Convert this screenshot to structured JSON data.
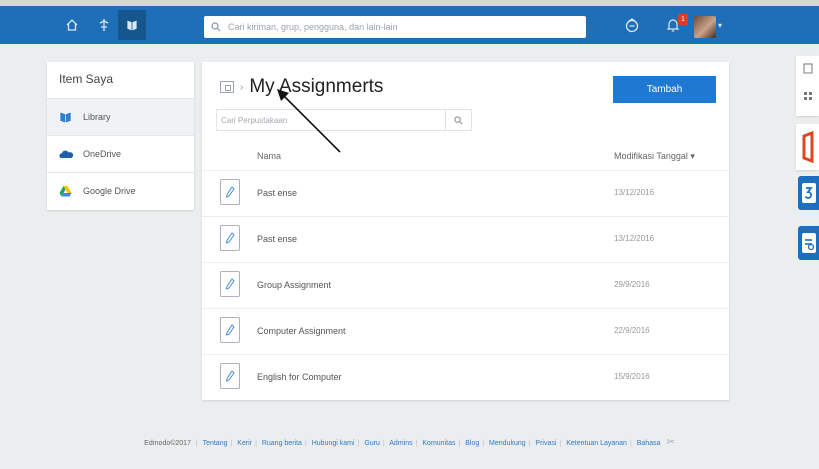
{
  "nav": {
    "search_placeholder": "Cari kiriman, grup, pengguna, dan lain-lain",
    "notification_count": "1"
  },
  "sidebar": {
    "title": "Item Saya",
    "items": [
      {
        "label": "Library",
        "icon": "library-icon"
      },
      {
        "label": "OneDrive",
        "icon": "onedrive-icon"
      },
      {
        "label": "Google Drive",
        "icon": "google-drive-icon"
      }
    ]
  },
  "main": {
    "title": "My Assignmerts",
    "add_label": "Tambah",
    "search_placeholder": "Cari Perpustakaan",
    "columns": {
      "name": "Nama",
      "date": "Modifikasi Tanggal ▾"
    },
    "rows": [
      {
        "name": "Past ense",
        "date": "13/12/2016"
      },
      {
        "name": "Past ense",
        "date": "13/12/2016"
      },
      {
        "name": "Group Assignment",
        "date": "29/9/2016"
      },
      {
        "name": "Computer Assignment",
        "date": "22/9/2016"
      },
      {
        "name": "English for Computer",
        "date": "15/9/2016"
      }
    ]
  },
  "footer": {
    "copyright": "Edmodo©2017",
    "links": [
      "Tentang",
      "Kerir",
      "Ruang berita",
      "Hubungi kami",
      "Guru",
      "Admins",
      "Komunitas",
      "Blog",
      "Mendukung",
      "Privasi",
      "Ketentuan Layanan",
      "Bahasa"
    ]
  },
  "colors": {
    "navbar": "#1f6fb8",
    "primary_button": "#1f78d1",
    "office_red": "#e0461e",
    "tile_blue": "#1c6fbf"
  }
}
